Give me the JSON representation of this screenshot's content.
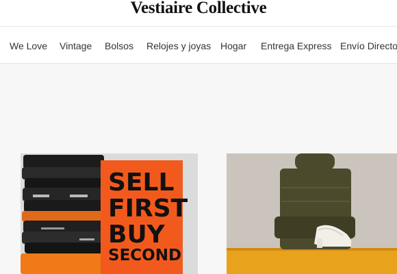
{
  "brand": {
    "logo_text": "Vestiaire Collective"
  },
  "nav": {
    "items": [
      {
        "label": "We Love"
      },
      {
        "label": "Vintage"
      },
      {
        "label": "Bolsos"
      },
      {
        "label": "Relojes y joyas"
      },
      {
        "label": "Hogar"
      },
      {
        "label": "Entrega Express"
      },
      {
        "label": "Envío Directo"
      }
    ]
  },
  "cards": [
    {
      "poster_lines": [
        "SELL",
        "FIRST",
        "BUY",
        "SECOND"
      ]
    },
    {}
  ],
  "colors": {
    "poster_orange": "#f25a1d",
    "sweater_green": "#4b4a2c",
    "shelf_orange": "#e8a21c"
  }
}
